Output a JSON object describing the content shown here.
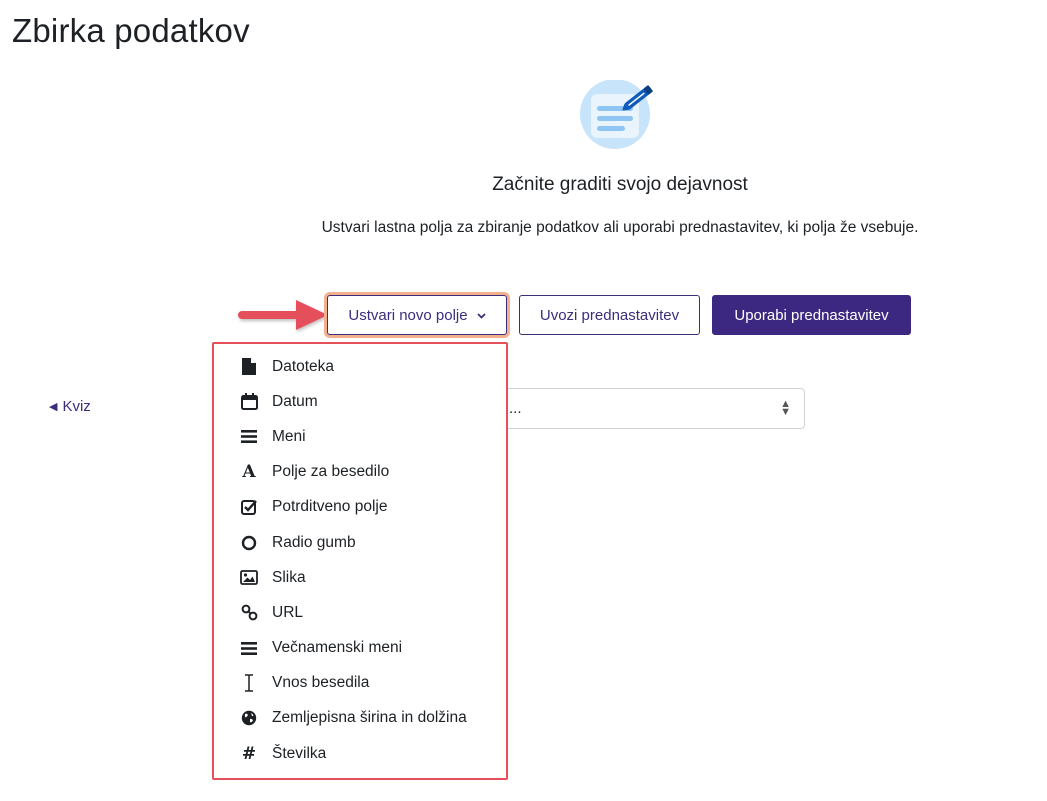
{
  "page": {
    "title": "Zbirka podatkov"
  },
  "empty_state": {
    "heading": "Začnite graditi svojo dejavnost",
    "text": "Ustvari lastna polja za zbiranje podatkov ali uporabi prednastavitev, ki polja že vsebuje."
  },
  "actions": {
    "create_label": "Ustvari novo polje",
    "import_label": "Uvozi prednastavitev",
    "use_label": "Uporabi prednastavitev"
  },
  "field_menu": {
    "items": [
      {
        "label": "Datoteka",
        "icon": "file-icon"
      },
      {
        "label": "Datum",
        "icon": "calendar-icon"
      },
      {
        "label": "Meni",
        "icon": "menu-icon"
      },
      {
        "label": "Polje za besedilo",
        "icon": "text-field-icon"
      },
      {
        "label": "Potrditveno polje",
        "icon": "checkbox-icon"
      },
      {
        "label": "Radio gumb",
        "icon": "radio-icon"
      },
      {
        "label": "Slika",
        "icon": "image-icon"
      },
      {
        "label": "URL",
        "icon": "link-icon"
      },
      {
        "label": "Večnamenski meni",
        "icon": "multimenu-icon"
      },
      {
        "label": "Vnos besedila",
        "icon": "text-cursor-icon"
      },
      {
        "label": "Zemljepisna širina in dolžina",
        "icon": "globe-icon"
      },
      {
        "label": "Številka",
        "icon": "hash-icon"
      }
    ]
  },
  "navigation": {
    "prev_link": "Kviz"
  },
  "jump_select": {
    "visible_text": "..."
  },
  "colors": {
    "brand": "#3c2880",
    "focus_ring": "#f3b08f",
    "annotation_red": "#e5505b",
    "hero_blue": "#c7e4fb"
  }
}
